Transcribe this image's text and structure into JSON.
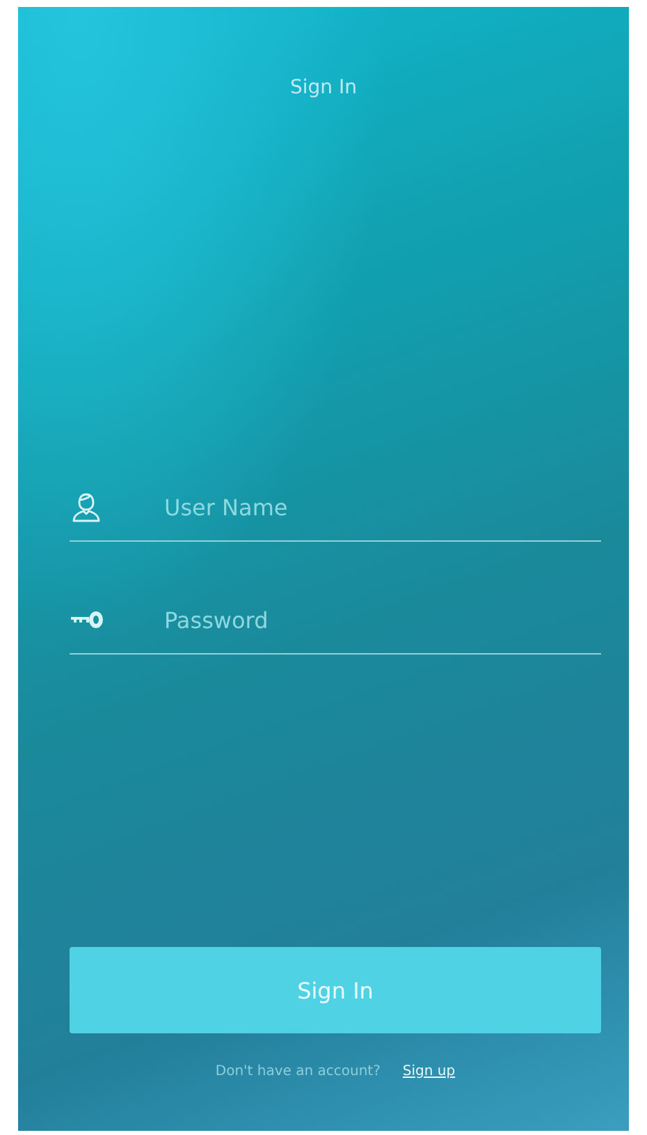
{
  "header": {
    "title": "Sign In"
  },
  "fields": [
    {
      "kind": "user",
      "placeholder": "User Name"
    },
    {
      "kind": "password",
      "placeholder": "Password"
    }
  ],
  "submit": {
    "label": "Sign In"
  },
  "footer": {
    "prompt": "Don't have an account?",
    "link": "Sign up"
  }
}
